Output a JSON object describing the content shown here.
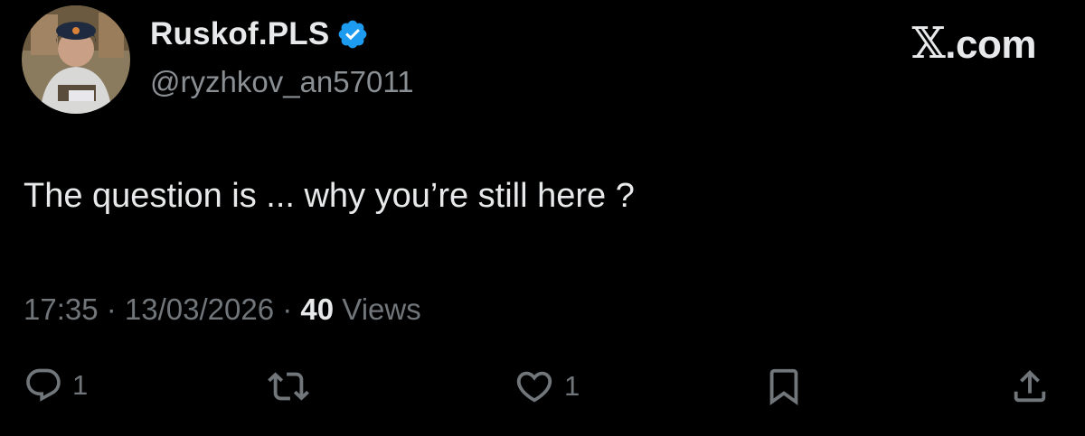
{
  "user": {
    "display_name": "Ruskof.PLS",
    "handle": "@ryzhkov_an57011",
    "verified_icon": "verified-badge-icon"
  },
  "brand": {
    "x_mark": "𝕏",
    "suffix": ".com"
  },
  "tweet": {
    "text": "The question is ... why you’re still here ?"
  },
  "meta": {
    "time": "17:35",
    "separator1": " · ",
    "date": "13/03/2026",
    "separator2": " · ",
    "views_count": "40",
    "views_label": " Views"
  },
  "actions": {
    "reply_count": "1",
    "like_count": "1"
  },
  "colors": {
    "background": "#000000",
    "primary_text": "#e7e9ea",
    "secondary_text": "#71767b",
    "verified": "#1d9bf0"
  }
}
